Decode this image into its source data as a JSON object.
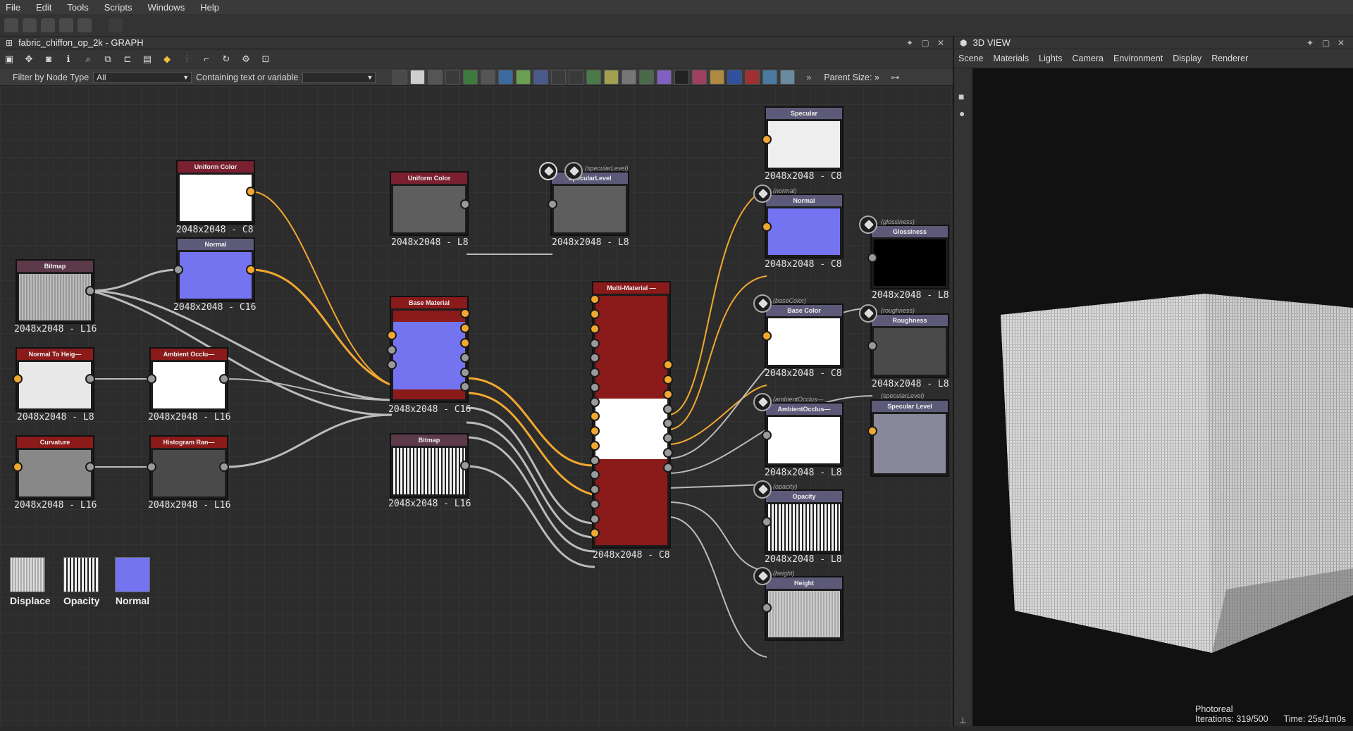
{
  "menu": [
    "File",
    "Edit",
    "Tools",
    "Scripts",
    "Windows",
    "Help"
  ],
  "graph": {
    "title": "fabric_chiffon_op_2k - GRAPH",
    "filter_label": "Filter by Node Type",
    "filter_value": "All",
    "contain_label": "Containing text or variable",
    "contain_value": "",
    "parent_size": "Parent Size: »"
  },
  "nodes": [
    {
      "id": "uniform1",
      "title": "Uniform Color",
      "label": "2048x2048 - C8"
    },
    {
      "id": "normal1",
      "title": "Normal",
      "label": "2048x2048 - C16"
    },
    {
      "id": "bitmap1",
      "title": "Bitmap",
      "label": "2048x2048 - L16"
    },
    {
      "id": "n2h",
      "title": "Normal To Heig—",
      "label": "2048x2048 - L8"
    },
    {
      "id": "ao1",
      "title": "Ambient Occlu—",
      "label": "2048x2048 - L16"
    },
    {
      "id": "curv",
      "title": "Curvature",
      "label": "2048x2048 - L16"
    },
    {
      "id": "histo",
      "title": "Histogram Ran—",
      "label": "2048x2048 - L16"
    },
    {
      "id": "uniform2",
      "title": "Uniform Color",
      "label": "2048x2048 - L8"
    },
    {
      "id": "speclvl",
      "title": "SpecularLevel",
      "label": "2048x2048 - L8",
      "italic": "(specularLevel)"
    },
    {
      "id": "basemat",
      "title": "Base Material",
      "label": "2048x2048 - C16"
    },
    {
      "id": "bitmap2",
      "title": "Bitmap",
      "label": "2048x2048 - L16"
    },
    {
      "id": "multimat",
      "title": "Multi-Material —",
      "label": "2048x2048 - C8"
    },
    {
      "id": "specular",
      "title": "Specular",
      "label": "2048x2048 - C8"
    },
    {
      "id": "normalout",
      "title": "Normal",
      "label": "2048x2048 - C8",
      "italic": "(normal)"
    },
    {
      "id": "gloss",
      "title": "Glossiness",
      "label": "2048x2048 - L8",
      "italic": "(glossiness)"
    },
    {
      "id": "basecolor",
      "title": "Base Color",
      "label": "2048x2048 - C8",
      "italic": "(baseColor)"
    },
    {
      "id": "rough",
      "title": "Roughness",
      "label": "2048x2048 - L8",
      "italic": "(roughness)"
    },
    {
      "id": "aoout",
      "title": "AmbientOcclus—",
      "label": "2048x2048 - L8",
      "italic": "(ambientOcclus—"
    },
    {
      "id": "speclvl2",
      "title": "Specular Level",
      "label": "",
      "italic": "(specularLevel)"
    },
    {
      "id": "opacity",
      "title": "Opacity",
      "label": "2048x2048 - L8",
      "italic": "(opacity)"
    },
    {
      "id": "height",
      "title": "Height",
      "label": "",
      "italic": "(height)"
    }
  ],
  "thumbs": [
    "Displace",
    "Opacity",
    "Normal"
  ],
  "view3d": {
    "title": "3D VIEW",
    "menu": [
      "Scene",
      "Materials",
      "Lights",
      "Camera",
      "Environment",
      "Display",
      "Renderer"
    ],
    "mode": "Photoreal",
    "iterations": "Iterations: 319/500",
    "time": "Time: 25s/1m0s"
  },
  "colors": {
    "accent": "#f2a830",
    "header_red": "#8b1a1a",
    "header_gray": "#5c5a78",
    "normal_blue": "#7070f0"
  }
}
